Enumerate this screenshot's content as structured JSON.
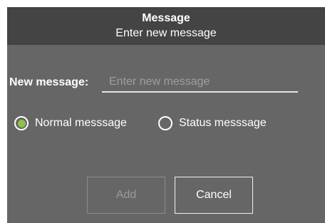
{
  "dialog": {
    "title": "Message",
    "subtitle": "Enter new message"
  },
  "form": {
    "message_label": "New message:",
    "message_value": "",
    "message_placeholder": "Enter new message"
  },
  "radio": {
    "selected": "normal",
    "selected_color": "#8bc34a",
    "options": [
      {
        "id": "normal",
        "label": "Normal messsage"
      },
      {
        "id": "status",
        "label": "Status messsage"
      }
    ]
  },
  "buttons": {
    "add_label": "Add",
    "add_enabled": false,
    "cancel_label": "Cancel"
  }
}
